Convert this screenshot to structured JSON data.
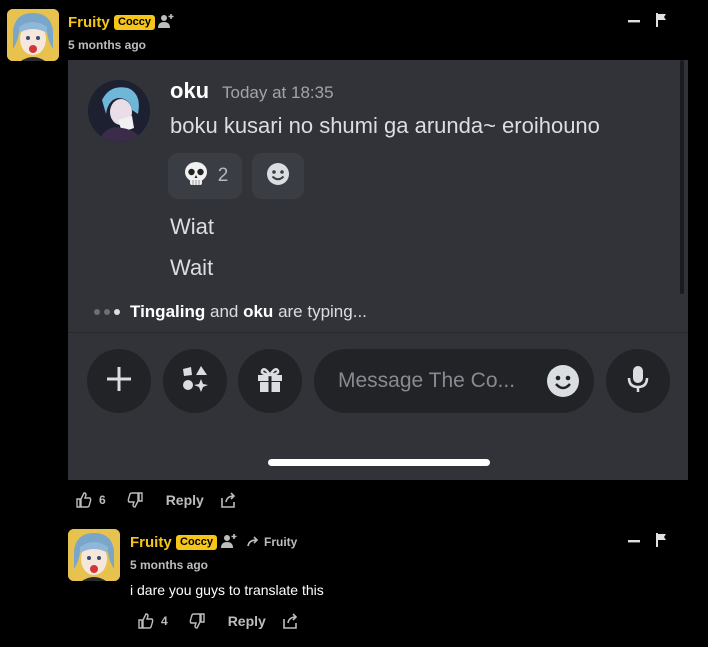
{
  "comments": [
    {
      "username": "Fruity",
      "badge": "Coccy",
      "time": "5 months ago",
      "likes": "6",
      "reply_label": "Reply",
      "text": ""
    },
    {
      "username": "Fruity",
      "badge": "Coccy",
      "reply_to": "Fruity",
      "time": "5 months ago",
      "text": "i dare you guys to translate this",
      "likes": "4",
      "reply_label": "Reply"
    }
  ],
  "embed": {
    "author": "oku",
    "timestamp": "Today at 18:35",
    "messages": [
      "boku kusari no shumi ga arunda~ eroihouno",
      "Wiat",
      "Wait"
    ],
    "reactions": [
      {
        "emoji": "skull-icon",
        "count": "2"
      }
    ],
    "typing": {
      "user1": "Tingaling",
      "mid": "and",
      "user2": "oku",
      "suffix": "are typing..."
    },
    "input_placeholder": "Message The Co..."
  },
  "colors": {
    "accent": "#f5c518",
    "embed_bg": "#313338",
    "bg": "#000000"
  }
}
